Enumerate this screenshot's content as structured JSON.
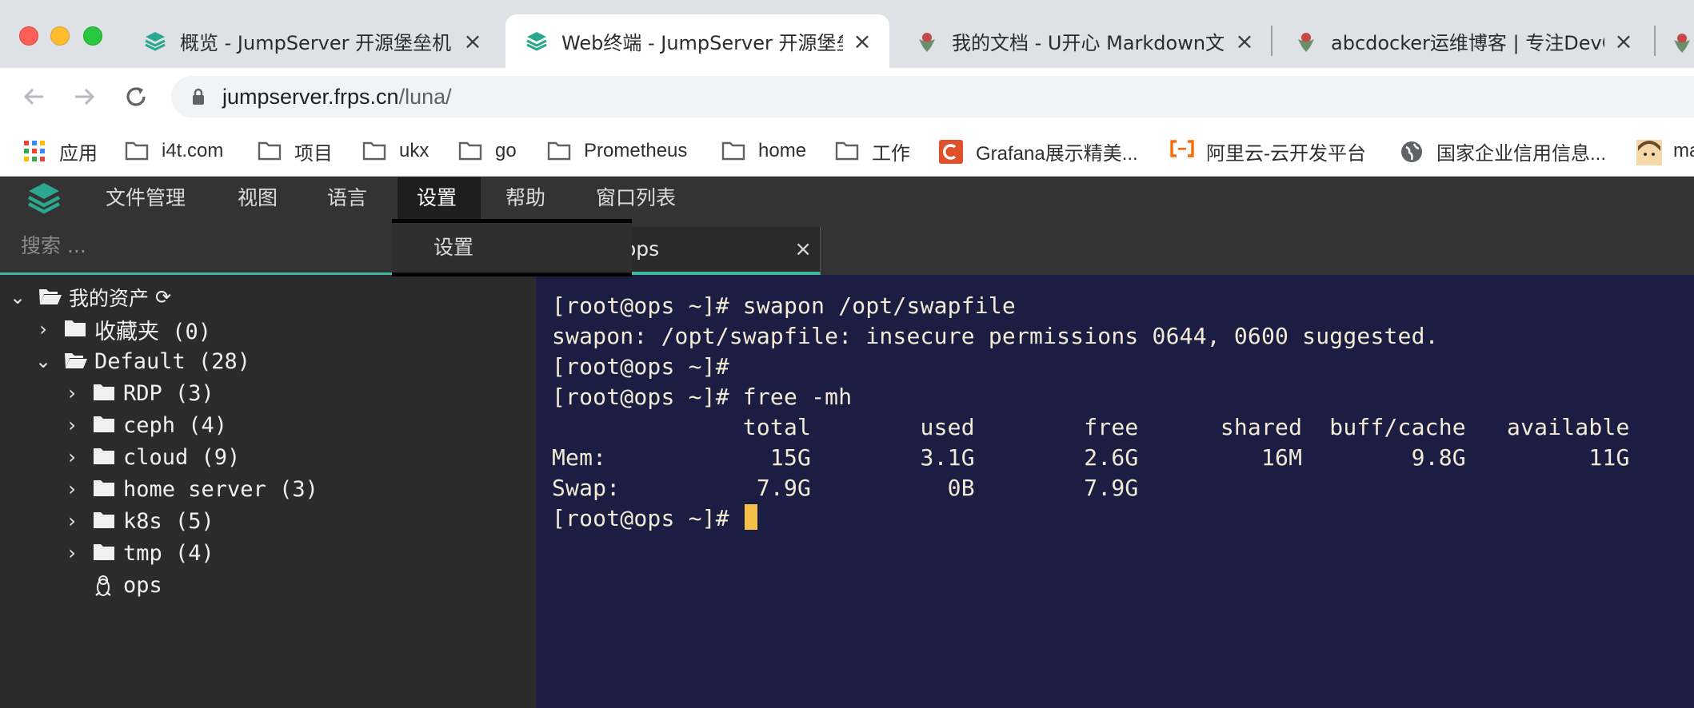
{
  "browser": {
    "tabs": [
      {
        "title": "概览 - JumpServer 开源堡垒机",
        "active": false,
        "icon": "jumpserver-logo-icon"
      },
      {
        "title": "Web终端 - JumpServer 开源堡垒机",
        "active": true,
        "icon": "jumpserver-logo-icon"
      },
      {
        "title": "我的文档 - U开心 Markdown文档",
        "active": false,
        "icon": "favicon-icon"
      },
      {
        "title": "abcdocker运维博客 | 专注DevOps",
        "active": false,
        "icon": "favicon-icon"
      }
    ],
    "url_host": "jumpserver.frps.cn",
    "url_path": "/luna/",
    "bookmarks": [
      "应用",
      "i4t.com",
      "项目",
      "ukx",
      "go",
      "Prometheus",
      "home",
      "工作",
      "Grafana展示精美...",
      "阿里云-云开发平台",
      "国家企业信用信息...",
      "ma"
    ]
  },
  "app": {
    "menu": [
      "文件管理",
      "视图",
      "语言",
      "设置",
      "帮助",
      "窗口列表"
    ],
    "open_menu_index": 3,
    "dropdown": [
      "设置"
    ],
    "search_placeholder": "搜索 ...",
    "terminal_tab": "ops",
    "tree": {
      "root": "我的资产",
      "favorites": "收藏夹 (0)",
      "default": "Default (28)",
      "groups": [
        "RDP (3)",
        "ceph (4)",
        "cloud (9)",
        "home server (3)",
        "k8s (5)",
        "tmp (4)"
      ],
      "host": "ops"
    },
    "terminal_lines": [
      "[root@ops ~]# swapon /opt/swapfile",
      "swapon: /opt/swapfile: insecure permissions 0644, 0600 suggested.",
      "[root@ops ~]#",
      "[root@ops ~]# free -mh",
      "              total        used        free      shared  buff/cache   available",
      "Mem:            15G        3.1G        2.6G         16M        9.8G         11G",
      "Swap:          7.9G          0B        7.9G",
      "[root@ops ~]# "
    ]
  },
  "colors": {
    "accent": "#3eb8a0",
    "terminal_bg": "#1b1d42",
    "cursor": "#f4c04a"
  }
}
